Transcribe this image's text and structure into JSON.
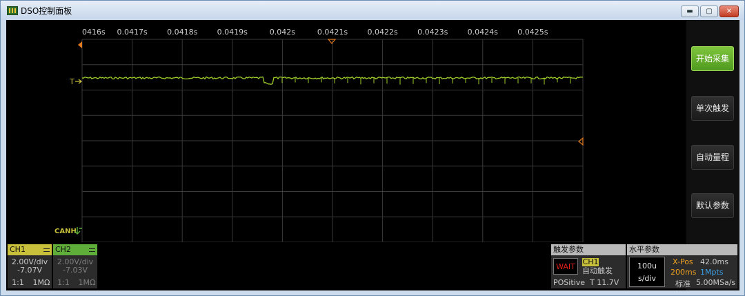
{
  "window": {
    "title": "DSO控制面板",
    "controls": {
      "minimize": "▬",
      "maximize": "▢",
      "close": "✕"
    }
  },
  "scope": {
    "time_labels": [
      "0416s",
      "0.0417s",
      "0.0418s",
      "0.0419s",
      "0.042s",
      "0.0421s",
      "0.0422s",
      "0.0423s",
      "0.0424s",
      "0.0425s"
    ],
    "trigger_marker": "T",
    "channel_marker": "CANH",
    "colors": {
      "ch1": "#c8c03a",
      "ch2": "#5fae3a",
      "trace": "#9fce2a",
      "marker": "#e07a1f",
      "grid": "#3a3a3a"
    }
  },
  "buttons": {
    "start": "开始采集",
    "single": "单次触发",
    "auto": "自动量程",
    "default": "默认参数"
  },
  "ch1": {
    "name": "CH1",
    "scale": "2.00V/div",
    "offset": "-7.07V",
    "probe": "1:1",
    "impedance": "1MΩ"
  },
  "ch2": {
    "name": "CH2",
    "scale": "2.00V/div",
    "offset": "-7.03V",
    "probe": "1:1",
    "impedance": "1MΩ"
  },
  "trigger": {
    "title": "触发参数",
    "status": "WAIT",
    "source": "CH1",
    "mode": "自动触发",
    "slope": "POSitive",
    "level": "T 11.7V"
  },
  "horizontal": {
    "title": "水平参数",
    "timebase_value": "100u",
    "timebase_unit": "s/div",
    "xpos_label": "X-Pos",
    "xpos_value": "42.0ms",
    "window": "200ms",
    "memory": "1Mpts",
    "mode": "标准",
    "sample_rate": "5.00MSa/s"
  }
}
